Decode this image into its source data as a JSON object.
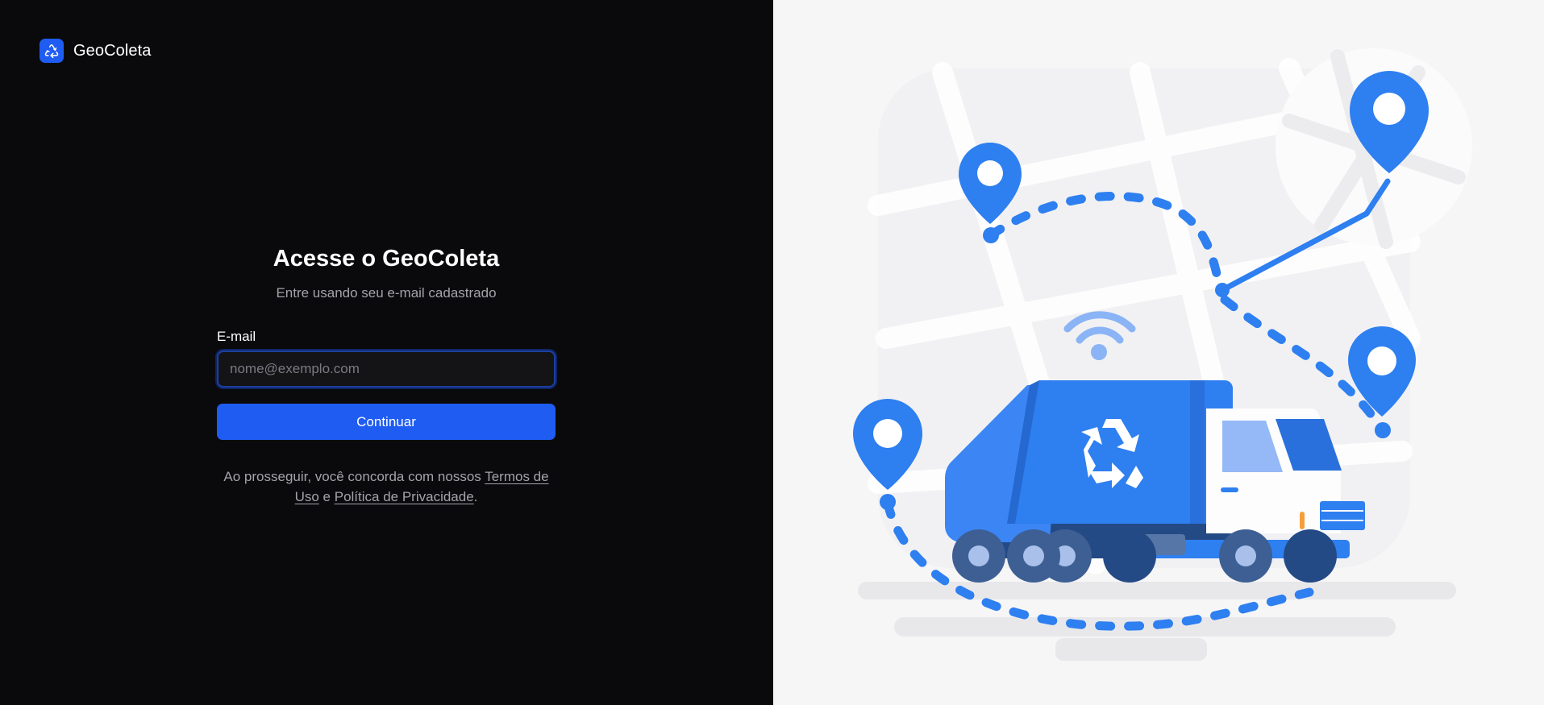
{
  "brand": {
    "name": "GeoColeta",
    "logo_icon": "recycle-icon",
    "accent": "#1f5cf2"
  },
  "login": {
    "title": "Acesse o GeoColeta",
    "subtitle": "Entre usando seu e-mail cadastrado",
    "email_label": "E-mail",
    "email_placeholder": "nome@exemplo.com",
    "email_value": "",
    "submit_label": "Continuar",
    "legal_prefix": "Ao prosseguir, você concorda com nossos ",
    "terms_link": "Termos de Uso",
    "legal_joiner": " e ",
    "privacy_link": "Política de Privacidade",
    "legal_suffix": "."
  },
  "illustration": {
    "subject": "garbage-truck-route-map",
    "icons": [
      "map-pin-icon",
      "recycle-icon",
      "wifi-signal-icon",
      "garbage-truck-icon"
    ],
    "primary_color": "#2e7ff0",
    "dark_color": "#244a86",
    "background_color": "#f6f6f7"
  }
}
